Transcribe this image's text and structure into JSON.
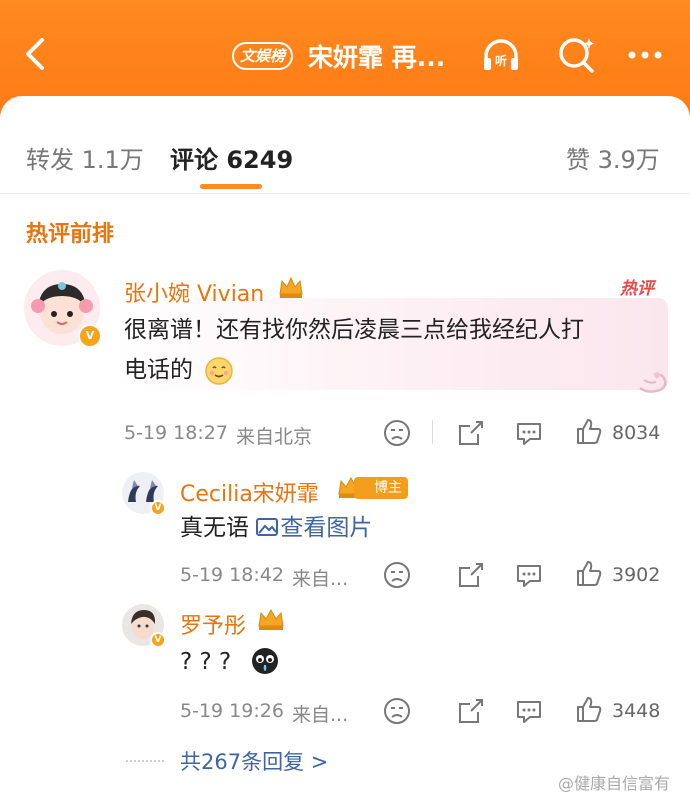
{
  "header": {
    "brand_badge": "文娱榜",
    "title": "宋妍霏 再..."
  },
  "tabs": [
    {
      "label": "转发 1.1万"
    },
    {
      "label": "评论 6249"
    },
    {
      "label": "赞 3.9万"
    }
  ],
  "section_title": "热评前排",
  "comment": {
    "user": "张小婉 Vivian",
    "hot_label": "热评",
    "text_line1": "很离谱！还有找你然后凌晨三点给我经纪人打",
    "text_line2": "电话的",
    "time": "5-19 18:27",
    "location": "来自北京",
    "likes": "8034"
  },
  "replies": [
    {
      "user": "Cecilia宋妍霏",
      "tag": "博主",
      "text": "真无语 ",
      "image_link": "查看图片",
      "time": "5-19 18:42",
      "location": "来自...",
      "likes": "3902"
    },
    {
      "user": "罗予彤",
      "text": "? ? ?",
      "time": "5-19 19:26",
      "location": "来自...",
      "likes": "3448"
    }
  ],
  "more_replies": "共267条回复 >",
  "watermark": "@健康自信富有",
  "colors": {
    "accent": "#ff8a1f",
    "name": "#e8740e",
    "link": "#3f64a3"
  }
}
